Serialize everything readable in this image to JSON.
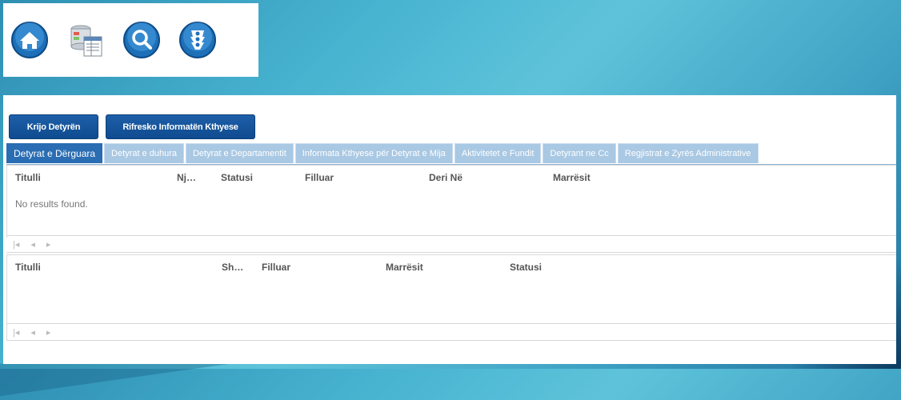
{
  "toolbar": {
    "icons": [
      "home-icon",
      "database-report-icon",
      "search-icon",
      "traffic-light-icon"
    ]
  },
  "actions": {
    "create_label": "Krijo Detyrën",
    "refresh_label": "Rifresko Informatën Kthyese"
  },
  "tabs": [
    {
      "label": "Detyrat e Dërguara",
      "active": true
    },
    {
      "label": "Detyrat e duhura",
      "active": false
    },
    {
      "label": "Detyrat e Departamentit",
      "active": false
    },
    {
      "label": "Informata Kthyese për Detyrat e Mija",
      "active": false
    },
    {
      "label": "Aktivitetet e Fundit",
      "active": false
    },
    {
      "label": "Detyrant ne Cc",
      "active": false
    },
    {
      "label": "Regjistrat e Zyrës Administrative",
      "active": false
    }
  ],
  "grid1": {
    "columns": [
      "Titulli",
      "Nj…",
      "Statusi",
      "Filluar",
      "Deri Në",
      "Marrësit"
    ],
    "empty_text": "No results found."
  },
  "grid2": {
    "columns": [
      "Titulli",
      "Sh…",
      "Filluar",
      "Marrësit",
      "Statusi"
    ]
  },
  "pager": {
    "first": "|◂",
    "prev": "◂",
    "next": "▸"
  },
  "colors": {
    "primary": "#1e5fa9",
    "tab_active": "#2a6db3",
    "tab_inactive": "#a9c8e3"
  }
}
